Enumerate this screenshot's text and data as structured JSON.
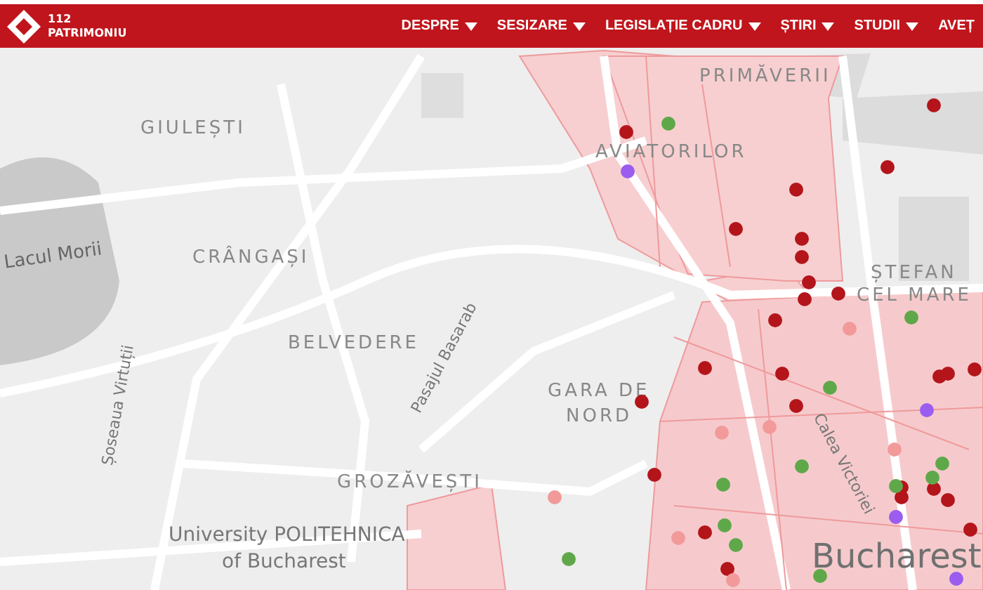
{
  "header": {
    "logo": {
      "line1": "112",
      "line2": "PATRIMONIU"
    },
    "nav": [
      {
        "label": "DESPRE",
        "dropdown": true
      },
      {
        "label": "SESIZARE",
        "dropdown": true
      },
      {
        "label": "LEGISLAȚIE CADRU",
        "dropdown": true
      },
      {
        "label": "ȘTIRI",
        "dropdown": true
      },
      {
        "label": "STUDII",
        "dropdown": true
      },
      {
        "label": "AVEȚ",
        "dropdown": false
      }
    ]
  },
  "map": {
    "labels": [
      {
        "text": "GIULEȘTI",
        "kind": "district"
      },
      {
        "text": "Lacul Morii",
        "kind": "water"
      },
      {
        "text": "CRÂNGAȘI",
        "kind": "district"
      },
      {
        "text": "BELVEDERE",
        "kind": "district"
      },
      {
        "text": "PRIMĂVERII",
        "kind": "district"
      },
      {
        "text": "AVIATORILOR",
        "kind": "district"
      },
      {
        "text": "ȘTEFAN",
        "kind": "district"
      },
      {
        "text": "CEL MARE",
        "kind": "district"
      },
      {
        "text": "GARA DE",
        "kind": "district"
      },
      {
        "text": "NORD",
        "kind": "district"
      },
      {
        "text": "Pasajul Basarab",
        "kind": "street"
      },
      {
        "text": "Calea Victoriei",
        "kind": "street"
      },
      {
        "text": "Șoseaua Virtuții",
        "kind": "street"
      },
      {
        "text": "GROZĂVEȘTI",
        "kind": "district"
      },
      {
        "text": "University POLITEHNICA",
        "kind": "landmark"
      },
      {
        "text": "of Bucharest",
        "kind": "landmark"
      },
      {
        "text": "Bucharest",
        "kind": "city"
      }
    ],
    "markers": [
      {
        "color": "#b3151b"
      },
      {
        "color": "#b3151b"
      },
      {
        "color": "#b3151b"
      },
      {
        "color": "#b3151b"
      },
      {
        "color": "#b3151b"
      },
      {
        "color": "#b3151b"
      },
      {
        "color": "#b3151b"
      },
      {
        "color": "#b3151b"
      },
      {
        "color": "#b3151b"
      },
      {
        "color": "#b3151b"
      },
      {
        "color": "#b3151b"
      },
      {
        "color": "#b3151b"
      },
      {
        "color": "#b3151b"
      },
      {
        "color": "#b3151b"
      },
      {
        "color": "#b3151b"
      },
      {
        "color": "#b3151b"
      },
      {
        "color": "#b3151b"
      },
      {
        "color": "#b3151b"
      },
      {
        "color": "#b3151b"
      },
      {
        "color": "#b3151b"
      },
      {
        "color": "#b3151b"
      },
      {
        "color": "#b3151b"
      },
      {
        "color": "#b3151b"
      },
      {
        "color": "#b3151b"
      },
      {
        "color": "#b3151b"
      },
      {
        "color": "#b3151b"
      },
      {
        "color": "#f29a9a"
      },
      {
        "color": "#f29a9a"
      },
      {
        "color": "#f29a9a"
      },
      {
        "color": "#f29a9a"
      },
      {
        "color": "#f29a9a"
      },
      {
        "color": "#f29a9a"
      },
      {
        "color": "#f29a9a"
      },
      {
        "color": "#5fa84a"
      },
      {
        "color": "#5fa84a"
      },
      {
        "color": "#5fa84a"
      },
      {
        "color": "#5fa84a"
      },
      {
        "color": "#5fa84a"
      },
      {
        "color": "#5fa84a"
      },
      {
        "color": "#5fa84a"
      },
      {
        "color": "#5fa84a"
      },
      {
        "color": "#5fa84a"
      },
      {
        "color": "#5fa84a"
      },
      {
        "color": "#5fa84a"
      },
      {
        "color": "#5fa84a"
      },
      {
        "color": "#9b5cf0"
      },
      {
        "color": "#9b5cf0"
      },
      {
        "color": "#9b5cf0"
      },
      {
        "color": "#9b5cf0"
      }
    ]
  }
}
